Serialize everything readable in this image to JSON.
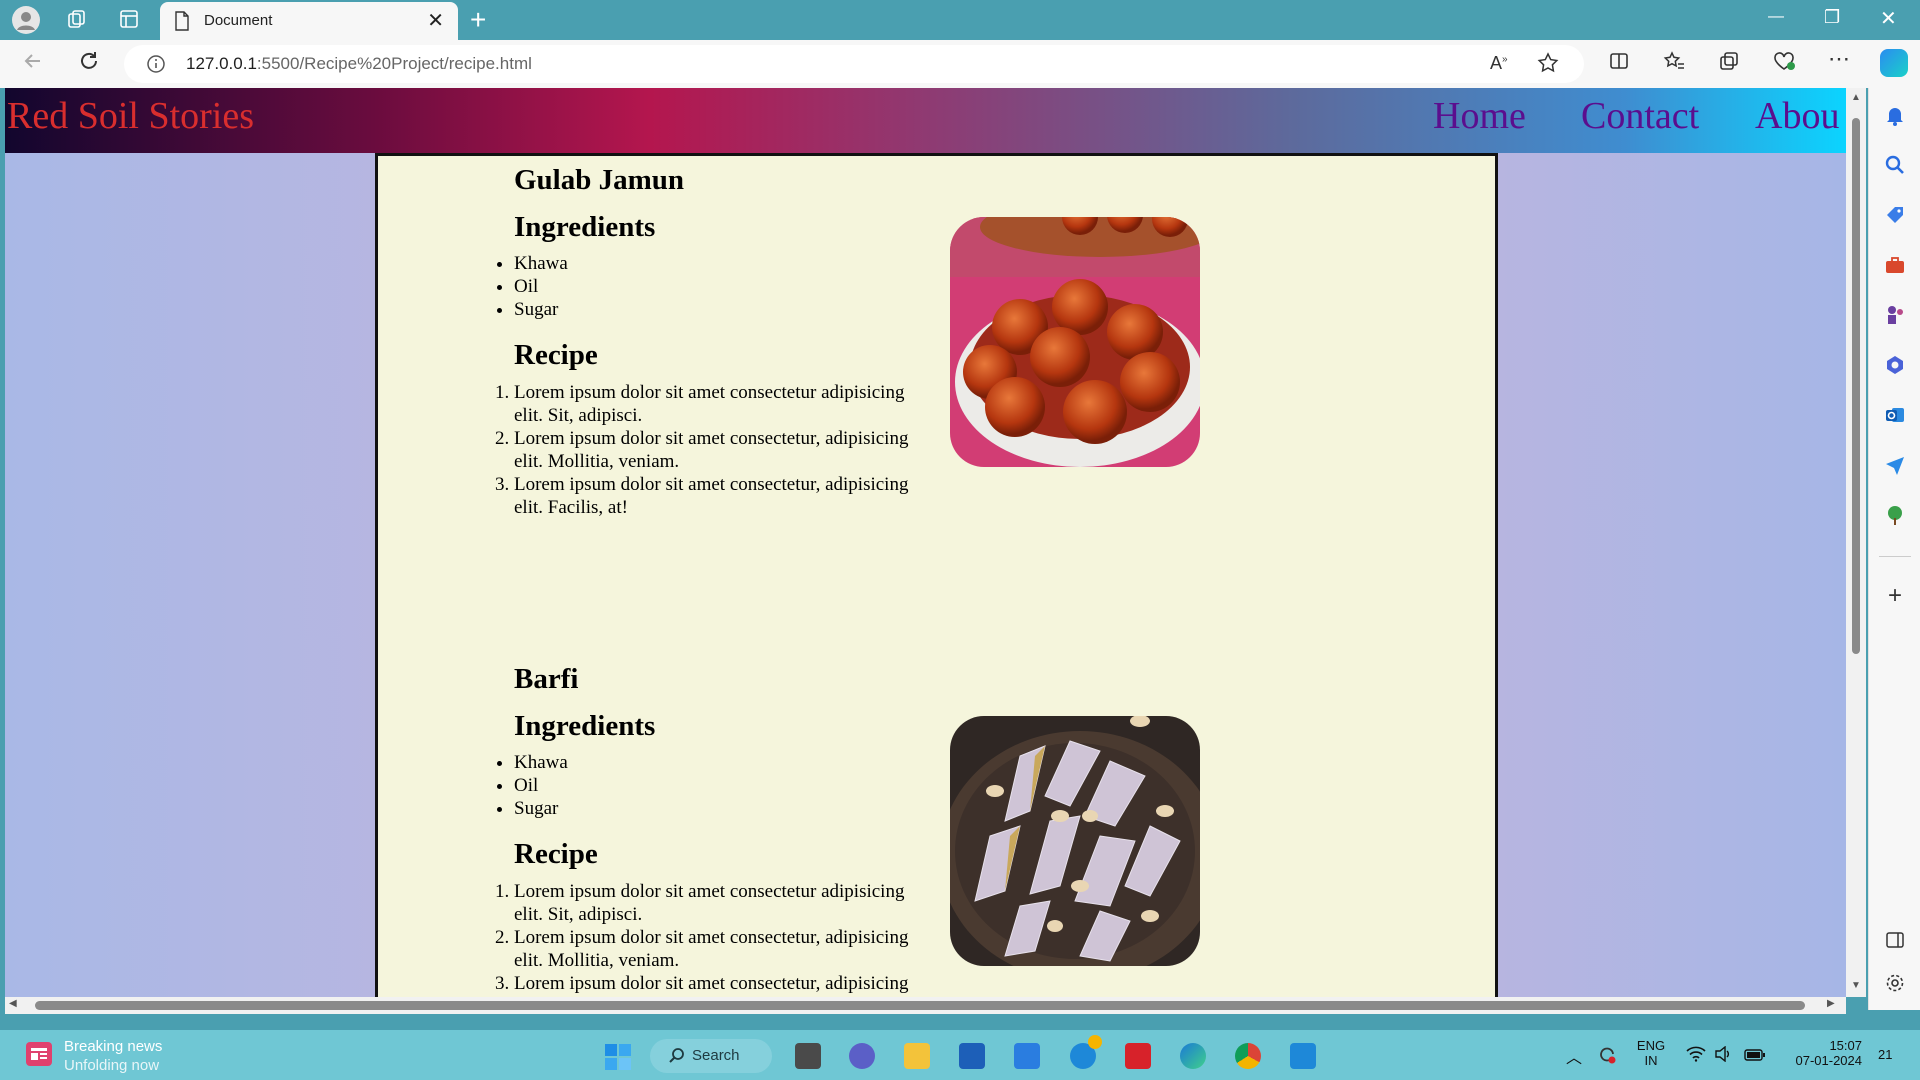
{
  "browser": {
    "tab_title": "Document",
    "tab_close": "✕",
    "new_tab": "+",
    "url_host": "127.0.0.1",
    "url_rest": ":5500/Recipe%20Project/recipe.html",
    "window_minimize": "—",
    "window_restore": "❐",
    "window_close": "✕",
    "sidebar_add": "+"
  },
  "site": {
    "brand": "Red Soil Stories",
    "nav": [
      "Home",
      "Contact",
      "Abou"
    ]
  },
  "recipes": [
    {
      "title": "Gulab Jamun",
      "ingredients_heading": "Ingredients",
      "ingredients": [
        "Khawa",
        "Oil",
        "Sugar"
      ],
      "recipe_heading": "Recipe",
      "steps": [
        "Lorem ipsum dolor sit amet consectetur adipisicing elit. Sit, adipisci.",
        "Lorem ipsum dolor sit amet consectetur, adipisicing elit. Mollitia, veniam.",
        "Lorem ipsum dolor sit amet consectetur, adipisicing elit. Facilis, at!"
      ],
      "image_icon": "gulab-jamun-photo"
    },
    {
      "title": "Barfi",
      "ingredients_heading": "Ingredients",
      "ingredients": [
        "Khawa",
        "Oil",
        "Sugar"
      ],
      "recipe_heading": "Recipe",
      "steps": [
        "Lorem ipsum dolor sit amet consectetur adipisicing elit. Sit, adipisci.",
        "Lorem ipsum dolor sit amet consectetur, adipisicing elit. Mollitia, veniam.",
        "Lorem ipsum dolor sit amet consectetur, adipisicing"
      ],
      "image_icon": "barfi-photo"
    }
  ],
  "taskbar": {
    "news_title": "Breaking news",
    "news_subtitle": "Unfolding now",
    "search_label": "Search",
    "language": "ENG",
    "region": "IN",
    "time": "15:07",
    "date": "07-01-2024",
    "notification_count": "21"
  },
  "colors": {
    "brand_text": "#d92e2e",
    "nav_text": "#5b0e8e",
    "content_bg": "#f5f5dc",
    "taskbar_bg": "#6fc7d4"
  }
}
